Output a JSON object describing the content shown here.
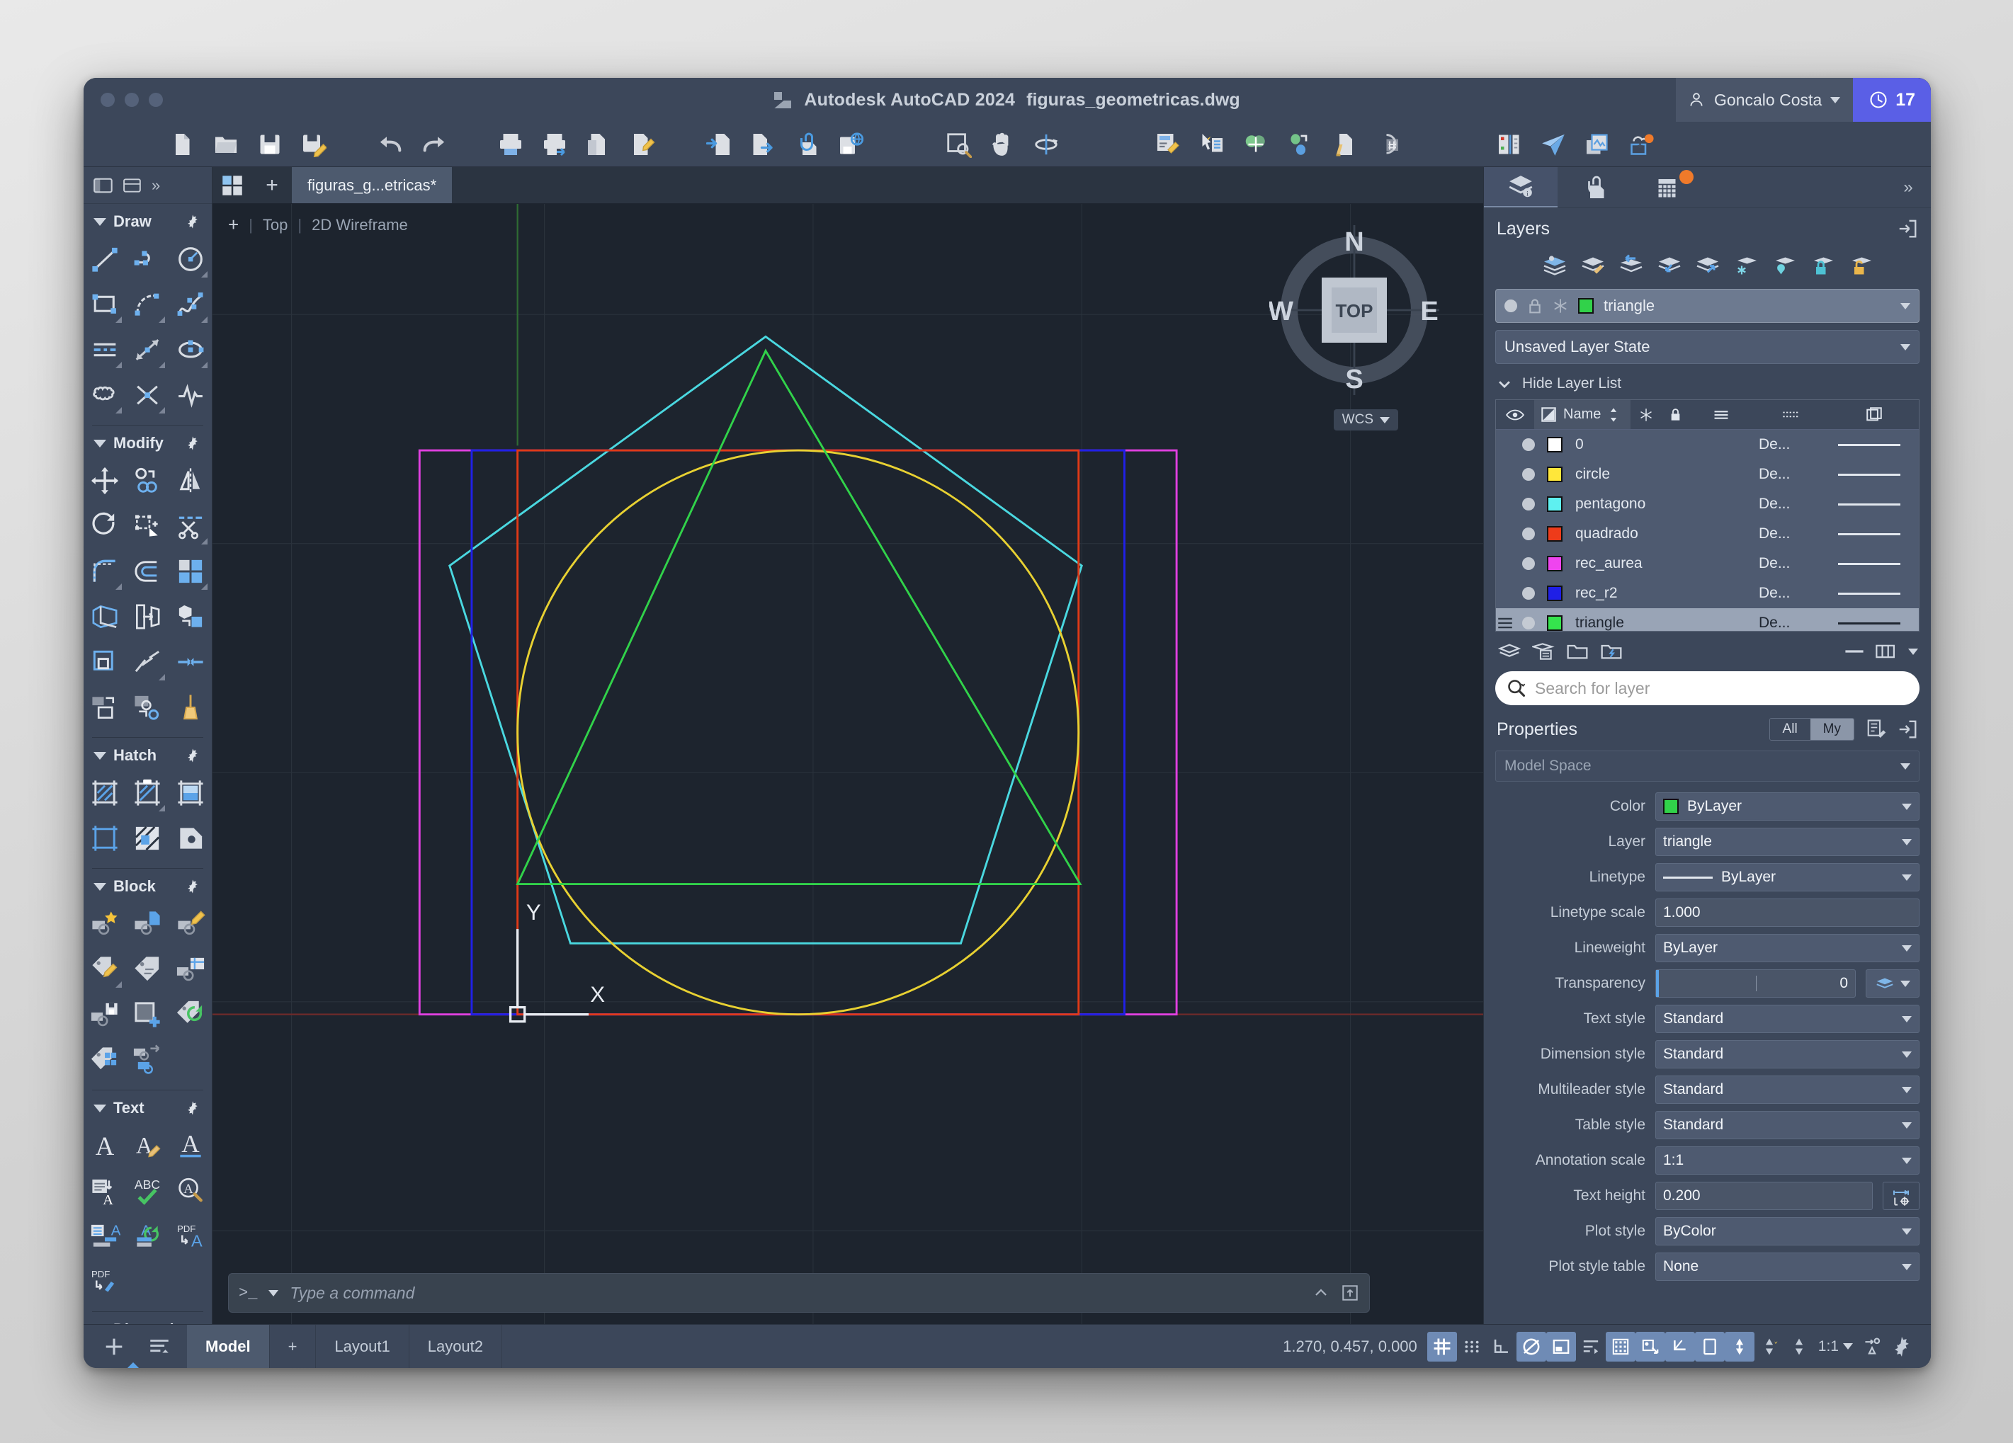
{
  "window": {
    "app_title": "Autodesk AutoCAD 2024",
    "file_name": "figuras_geometricas.dwg",
    "user_name": "Goncalo Costa",
    "badge_count": "17",
    "traffic_lights": [
      "close",
      "minimize",
      "zoom"
    ]
  },
  "quick_toolbar": {
    "groups": [
      {
        "items": [
          {
            "name": "new-file-icon",
            "label": "New"
          },
          {
            "name": "open-file-icon",
            "label": "Open"
          },
          {
            "name": "save-icon",
            "label": "Save"
          },
          {
            "name": "save-as-icon",
            "label": "Save As"
          }
        ]
      },
      {
        "items": [
          {
            "name": "undo-icon",
            "label": "Undo"
          },
          {
            "name": "redo-icon",
            "label": "Redo"
          }
        ]
      },
      {
        "items": [
          {
            "name": "plot-icon",
            "label": "Plot"
          },
          {
            "name": "plot-preview-icon",
            "label": "Plot Preview"
          },
          {
            "name": "publish-icon",
            "label": "Publish"
          },
          {
            "name": "page-setup-icon",
            "label": "Page Setup"
          }
        ]
      },
      {
        "items": [
          {
            "name": "import-icon",
            "label": "Import"
          },
          {
            "name": "export-icon",
            "label": "Export"
          },
          {
            "name": "attach-icon",
            "label": "Attach"
          },
          {
            "name": "save-to-web-icon",
            "label": "Save to Web & Mobile"
          }
        ]
      },
      {
        "items": [
          {
            "name": "zoom-window-icon",
            "label": "Zoom Window"
          },
          {
            "name": "pan-icon",
            "label": "Pan"
          },
          {
            "name": "orbit-icon",
            "label": "Orbit"
          }
        ]
      },
      {
        "items": [
          {
            "name": "properties-icon",
            "label": "Properties"
          },
          {
            "name": "quick-select-icon",
            "label": "Quick Select"
          },
          {
            "name": "match-properties-icon",
            "label": "Match Properties"
          },
          {
            "name": "group-icon",
            "label": "Group"
          },
          {
            "name": "purge-icon",
            "label": "Purge"
          },
          {
            "name": "measure-icon",
            "label": "Measure"
          }
        ]
      },
      {
        "items": [
          {
            "name": "sheet-set-icon",
            "label": "Sheet Set Manager"
          },
          {
            "name": "send-icon",
            "label": "Send"
          },
          {
            "name": "drawing-compare-icon",
            "label": "Drawing Compare"
          },
          {
            "name": "cloud-sync-icon",
            "label": "Cloud Sync"
          }
        ]
      }
    ]
  },
  "left_palette": {
    "header_icons": [
      "workspace-icon",
      "layout-icon",
      "overflow-icon"
    ],
    "sections": [
      {
        "title": "Draw",
        "tools": [
          "line-icon",
          "polyline-icon",
          "circle-icon",
          "rectangle-icon",
          "arc-icon",
          "spline-icon",
          "construction-line-icon",
          "ray-icon",
          "ellipse-icon",
          "revision-cloud-icon",
          "point-icon",
          "wipeout-icon"
        ]
      },
      {
        "title": "Modify",
        "tools": [
          "move-icon",
          "copy-icon",
          "mirror-icon",
          "rotate-icon",
          "scale-icon",
          "trim-icon",
          "fillet-icon",
          "offset-icon",
          "array-icon",
          "extrude-icon",
          "stretch-icon",
          "3d-move-icon",
          "explode-icon",
          "break-icon",
          "join-icon",
          "align-icon",
          "convert-icon",
          "erase-brush-icon"
        ]
      },
      {
        "title": "Hatch",
        "tools": [
          "hatch-icon",
          "gradient-icon",
          "solid-fill-icon",
          "boundary-icon",
          "hatch-edit-icon",
          "region-icon"
        ]
      },
      {
        "title": "Block",
        "tools": [
          "create-block-icon",
          "insert-block-icon",
          "block-editor-icon",
          "edit-attribute-icon",
          "define-attribute-icon",
          "block-table-icon",
          "write-block-icon",
          "add-block-icon",
          "sync-attribute-icon",
          "block-array-icon",
          "block-replace-icon"
        ]
      },
      {
        "title": "Text",
        "tools": [
          "single-text-icon",
          "text-style-icon",
          "multiline-text-icon",
          "text-align-icon",
          "spell-check-icon",
          "find-text-icon",
          "table-text-icon",
          "update-text-icon",
          "pdf-text-import-icon",
          "pdf-edit-icon"
        ]
      },
      {
        "title": "Dimension",
        "tools": []
      }
    ]
  },
  "document_tabs": {
    "start_icon": "start-tab-icon",
    "new_tab_label": "+",
    "tabs": [
      {
        "label": "figuras_g...etricas*",
        "active": true
      }
    ]
  },
  "viewport": {
    "view_label": "Top",
    "visual_style_label": "2D Wireframe",
    "plus_label": "+",
    "viewcube": {
      "top_face_label": "TOP",
      "north_label": "N",
      "east_label": "E",
      "south_label": "S",
      "west_label": "W"
    },
    "wcs_label": "WCS",
    "ucs_x_label": "X",
    "ucs_y_label": "Y"
  },
  "drawing": {
    "shapes": [
      {
        "name": "pentagon",
        "layer": "pentagono",
        "color": "#4ad8e0"
      },
      {
        "name": "circle",
        "layer": "circle",
        "color": "#e8d132"
      },
      {
        "name": "triangle",
        "layer": "triangle",
        "color": "#31d24a"
      },
      {
        "name": "square",
        "layer": "quadrado",
        "color": "#e03a17"
      },
      {
        "name": "golden-rectangle",
        "layer": "rec_aurea",
        "color": "#e040e0"
      },
      {
        "name": "rectangle-r2",
        "layer": "rec_r2",
        "color": "#2020e8"
      }
    ]
  },
  "command_line": {
    "prompt": ">_",
    "placeholder": "Type a command",
    "value": ""
  },
  "right_panel": {
    "tabs": [
      {
        "name": "layers-tab",
        "active": true
      },
      {
        "name": "external-references-tab",
        "active": false
      },
      {
        "name": "sheet-set-tab",
        "active": false,
        "badge": true
      }
    ],
    "overflow_label": "»",
    "layers": {
      "title": "Layers",
      "tool_icons": [
        "layer-properties-icon",
        "layer-match-icon",
        "layer-previous-icon",
        "layer-make-current-icon",
        "layer-isolate-icon",
        "layer-freeze-icon",
        "layer-off-icon",
        "layer-lock-icon",
        "layer-unlock-icon"
      ],
      "current_layer": "triangle",
      "current_layer_color": "#31d24a",
      "layer_state": "Unsaved Layer State",
      "hide_layer_list_label": "Hide Layer List",
      "columns": [
        {
          "name": "visibility-column",
          "icon": "eye-icon"
        },
        {
          "name": "name-column",
          "label": "Name",
          "sorted": "asc"
        },
        {
          "name": "freeze-column",
          "icon": "snowflake-icon"
        },
        {
          "name": "lock-column",
          "icon": "lock-icon"
        },
        {
          "name": "lineweight-column",
          "icon": "lineweight-icon"
        },
        {
          "name": "linetype-column",
          "icon": "linetype-icon"
        },
        {
          "name": "plot-column",
          "icon": "plot-icon"
        }
      ],
      "rows": [
        {
          "name": "0",
          "color": "#ffffff",
          "lineweight": "De...",
          "selected": false
        },
        {
          "name": "circle",
          "color": "#ffe73a",
          "lineweight": "De...",
          "selected": false
        },
        {
          "name": "pentagono",
          "color": "#5ef0f0",
          "lineweight": "De...",
          "selected": false
        },
        {
          "name": "quadrado",
          "color": "#ee3b1a",
          "lineweight": "De...",
          "selected": false
        },
        {
          "name": "rec_aurea",
          "color": "#ef44ef",
          "lineweight": "De...",
          "selected": false
        },
        {
          "name": "rec_r2",
          "color": "#1f1fe6",
          "lineweight": "De...",
          "selected": false
        },
        {
          "name": "triangle",
          "color": "#35e34d",
          "lineweight": "De...",
          "selected": true
        }
      ],
      "footer_icons": [
        "new-layer-icon",
        "new-layer-vp-frozen-icon",
        "layer-group-icon",
        "layer-filter-icon"
      ],
      "collapse_icon": "minus-icon",
      "columns_icon": "columns-icon",
      "search_placeholder": "Search for layer",
      "search_value": ""
    },
    "properties": {
      "title": "Properties",
      "filter_all_label": "All",
      "filter_my_label": "My",
      "filter_selected": "My",
      "context": "Model Space",
      "rows": [
        {
          "label": "Color",
          "value": "ByLayer",
          "type": "color",
          "swatch": "#31d24a"
        },
        {
          "label": "Layer",
          "value": "triangle",
          "type": "select"
        },
        {
          "label": "Linetype",
          "value": "ByLayer",
          "type": "linetype"
        },
        {
          "label": "Linetype scale",
          "value": "1.000",
          "type": "input"
        },
        {
          "label": "Lineweight",
          "value": "ByLayer",
          "type": "select"
        },
        {
          "label": "Transparency",
          "value": "0",
          "type": "slider"
        },
        {
          "label": "Text style",
          "value": "Standard",
          "type": "select"
        },
        {
          "label": "Dimension style",
          "value": "Standard",
          "type": "select"
        },
        {
          "label": "Multileader style",
          "value": "Standard",
          "type": "select"
        },
        {
          "label": "Table style",
          "value": "Standard",
          "type": "select"
        },
        {
          "label": "Annotation scale",
          "value": "1:1",
          "type": "select"
        },
        {
          "label": "Text height",
          "value": "0.200",
          "type": "input-measure"
        },
        {
          "label": "Plot style",
          "value": "ByColor",
          "type": "select"
        },
        {
          "label": "Plot style table",
          "value": "None",
          "type": "select"
        }
      ]
    }
  },
  "status_bar": {
    "left_icons": [
      "add-tab-icon",
      "layout-list-icon"
    ],
    "tabs": [
      {
        "label": "Model",
        "active": true
      },
      {
        "label": "+",
        "active": false
      },
      {
        "label": "Layout1",
        "active": false
      },
      {
        "label": "Layout2",
        "active": false
      }
    ],
    "coordinates": "1.270, 0.457, 0.000",
    "toggles": [
      {
        "name": "grid-display-toggle",
        "on": true
      },
      {
        "name": "snap-mode-toggle",
        "on": false
      },
      {
        "name": "ortho-mode-toggle",
        "on": false
      },
      {
        "name": "polar-tracking-toggle",
        "on": true
      },
      {
        "name": "isometric-drafting-toggle",
        "on": true
      },
      {
        "name": "object-snap-tracking-toggle",
        "on": false
      },
      {
        "name": "object-snap-toggle",
        "on": true
      },
      {
        "name": "show-annotation-objects-toggle",
        "on": true
      },
      {
        "name": "lineweight-toggle",
        "on": true
      },
      {
        "name": "transparency-toggle",
        "on": true
      },
      {
        "name": "selection-cycling-toggle",
        "on": true
      },
      {
        "name": "annotation-visibility-toggle",
        "on": false
      },
      {
        "name": "autoscale-toggle",
        "on": false
      }
    ],
    "annotation_scale": "1:1",
    "right_icons": [
      "workspace-switch-icon",
      "customization-icon"
    ]
  }
}
